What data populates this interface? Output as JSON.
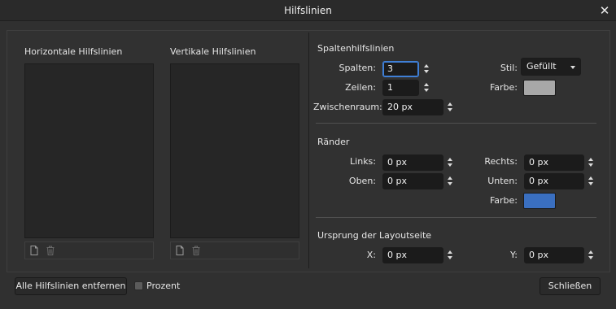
{
  "window": {
    "title": "Hilfslinien"
  },
  "lists": {
    "horizontal_label": "Horizontale Hilfslinien",
    "vertical_label": "Vertikale Hilfslinien"
  },
  "columns": {
    "section_title": "Spaltenhilfslinien",
    "spalten_label": "Spalten:",
    "spalten_value": "3",
    "zeilen_label": "Zeilen:",
    "zeilen_value": "1",
    "zwischenraum_label": "Zwischenraum:",
    "zwischenraum_value": "20 px",
    "stil_label": "Stil:",
    "stil_value": "Gefüllt",
    "farbe_label": "Farbe:",
    "farbe_color": "#a8a8a8"
  },
  "margins": {
    "section_title": "Ränder",
    "links_label": "Links:",
    "links_value": "0 px",
    "oben_label": "Oben:",
    "oben_value": "0 px",
    "rechts_label": "Rechts:",
    "rechts_value": "0 px",
    "unten_label": "Unten:",
    "unten_value": "0 px",
    "farbe_label": "Farbe:",
    "farbe_color": "#3a6fc0"
  },
  "origin": {
    "section_title": "Ursprung der Layoutseite",
    "x_label": "X:",
    "x_value": "0 px",
    "y_label": "Y:",
    "y_value": "0 px"
  },
  "footer": {
    "remove_all_label": "Alle Hilfslinien entfernen",
    "prozent_label": "Prozent",
    "close_label": "Schließen"
  }
}
